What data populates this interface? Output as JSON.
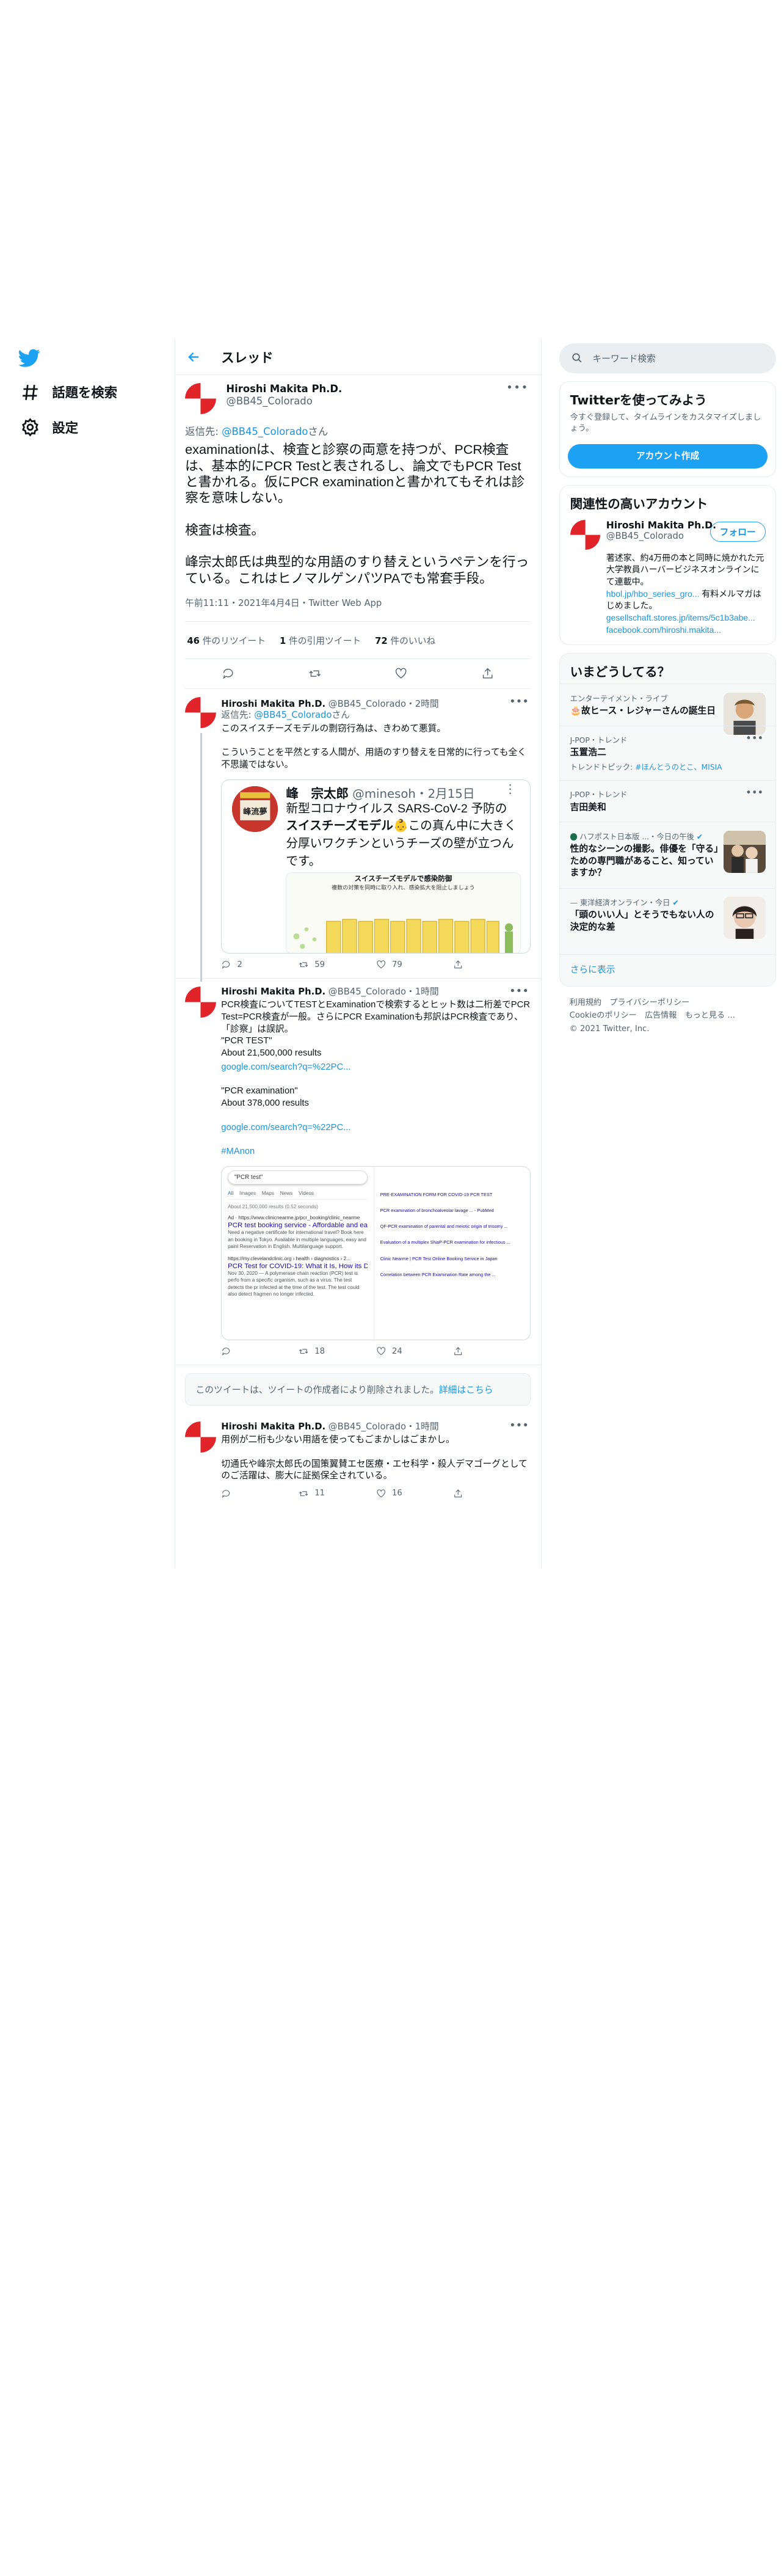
{
  "nav": {
    "explore": "話題を検索",
    "settings": "設定"
  },
  "header": {
    "title": "スレッド"
  },
  "main_tweet": {
    "name": "Hiroshi Makita Ph.D.",
    "handle": "@BB45_Colorado",
    "reply_prefix": "返信先: ",
    "reply_handle": "@BB45_Colorado",
    "reply_suffix": "さん",
    "text": "examinationは、検査と診察の両意を持つが、PCR検査は、基本的にPCR Testと表されるし、論文でもPCR Testと書かれる。仮にPCR examinationと書かれてもそれは診察を意味しない。\n\n検査は検査。\n\n峰宗太郎氏は典型的な用語のすり替えというペテンを行っている。これはヒノマルゲンパツPAでも常套手段。",
    "meta": "午前11:11・2021年4月4日・Twitter Web App",
    "retweets_count": "46",
    "retweets_label": " 件のリツイート",
    "quotes_count": "1",
    "quotes_label": " 件の引用ツイート",
    "likes_count": "72",
    "likes_label": " 件のいいね"
  },
  "reply1": {
    "name": "Hiroshi Makita Ph.D.",
    "meta": "@BB45_Colorado・2時間",
    "reply_prefix": "返信先: ",
    "reply_handle": "@BB45_Colorado",
    "reply_suffix": "さん",
    "text": "このスイスチーズモデルの剽窃行為は、きわめて悪質。\n\nこういうことを平然とする人間が、用語のすり替えを日常的に行っても全く不思議ではない。",
    "quote": {
      "name": "峰　宗太郎",
      "meta": "@minesoh・2月15日",
      "text_a": "新型コロナウイルス SARS-CoV-2 予防の",
      "text_b": "スイスチーズモデル",
      "text_c": "この真ん中に大きく分厚いワクチンというチーズの壁が立つんです。",
      "image_title": "スイスチーズモデルで感染防御",
      "image_sub": "複数の対策を同時に取り入れ、感染拡大を阻止しましょう",
      "avatar_text": "峰流夢"
    },
    "replies": "2",
    "retweets": "59",
    "likes": "79"
  },
  "reply2": {
    "name": "Hiroshi Makita Ph.D.",
    "meta": "@BB45_Colorado・1時間",
    "text": "PCR検査についてTESTとExaminationで検索するとヒット数は二桁差でPCR Test=PCR検査が一般。さらにPCR Examinationも邦訳はPCR検査であり、「診察」は誤訳。\n\"PCR TEST\"\nAbout 21,500,000 results",
    "link1": "google.com/search?q=%22PC...",
    "text2": "\"PCR examination\"\nAbout 378,000 results",
    "link2": "google.com/search?q=%22PC...",
    "hashtag": "#MAnon",
    "shot": {
      "query": "\"PCR test\"",
      "tabs": [
        "All",
        "Images",
        "Maps",
        "News",
        "Videos"
      ],
      "count": "About 21,500,000 results (0.52 seconds)",
      "ad": "Ad · https://www.clinicnearme.jp/pcr_booking/clinic_nearme",
      "r1": "PCR test booking service - Affordable and ea",
      "r1d": "Need a negative certificate for international travel? Book here an booking in Tokyo. Available in multiple languages, easy and painl Reservation in English. Multilanguage support.",
      "src2": "https://my.clevelandclinic.org › health › diagnostics › 2...",
      "r2": "PCR Test for COVID-19: What it Is, How its D",
      "r2d": "Nov 30, 2020 — A polymerase chain reaction (PCR) test is perfo from a specific organism, such as a virus. The test detects the pr infected at the time of the test. The test could also detect fragmen no longer infected.",
      "right1": "PRE-EXAMINATION FORM FOR COVID-19 PCR TEST",
      "right2": "PCR examination of bronchoalveolar lavage ... - PubMed",
      "right3": "QF-PCR examination of parental and meiotic origin of trisomy ...",
      "right4": "Evaluation of a multiplex SNaP-PCR examination for infectious ...",
      "right5": "Clinic Nearme | PCR Test Online Booking Service in Japan",
      "right6": "Correlation between PCR Examination Rate among the ..."
    },
    "replies": "",
    "retweets": "18",
    "likes": "24"
  },
  "deleted": {
    "text": "このツイートは、ツイートの作成者により削除されました。",
    "link": "詳細はこちら"
  },
  "reply3": {
    "name": "Hiroshi Makita Ph.D.",
    "meta": "@BB45_Colorado・1時間",
    "text": "用例が二桁も少ない用語を使ってもごまかしはごまかし。\n\n切通氏や峰宗太郎氏の国策翼賛エセ医療・エセ科学・殺人デマゴーグとしてのご活躍は、膨大に証拠保全されている。",
    "retweets": "11",
    "likes": "16"
  },
  "right": {
    "search_placeholder": "キーワード検索",
    "signup": {
      "title": "Twitterを使ってみよう",
      "desc": "今すぐ登録して、タイムラインをカスタマイズしましょう。",
      "button": "アカウント作成"
    },
    "related": {
      "title": "関連性の高いアカウント",
      "name": "Hiroshi Makita Ph.D.",
      "handle": "@BB45_Colorado",
      "follow": "フォロー",
      "bio1": "著述家、約4万冊の本と同時に焼かれた元大学教員ハーバービジネスオンラインにて連載中。",
      "bio_link1": "hbol.jp/hbo_series_gro...",
      "bio2": " 有料メルマガはじめました。",
      "bio_link2": "gesellschaft.stores.jp/items/5c1b3abe...",
      "bio_link3": " facebook.com/hiroshi.makita..."
    },
    "trends": {
      "title": "いまどうしてる？",
      "items": [
        {
          "meta": "エンターテイメント・ライブ",
          "title": "🎂故ヒース・レジャーさんの誕生日",
          "sub": ""
        },
        {
          "meta": "J-POP・トレンド",
          "title": "玉置浩二",
          "sub": "トレンドトピック: ",
          "sub_link": "#ほんとうのとこ、MISIA"
        },
        {
          "meta": "J-POP・トレンド",
          "title": "吉田美和",
          "sub": ""
        },
        {
          "meta": "ハフポスト日本版 ...・今日の午後",
          "title": "性的なシーンの撮影。俳優を「守る」ための専門職があること、知っていますか？",
          "sub": ""
        },
        {
          "meta": "東洋経済オンライン・今日",
          "title": "「頭のいい人」とそうでもない人の決定的な差",
          "sub": ""
        }
      ],
      "more": "さらに表示"
    },
    "footer": [
      "利用規約",
      "プライバシーポリシー",
      "Cookieのポリシー",
      "広告情報",
      "もっと見る ...",
      "© 2021 Twitter, Inc."
    ]
  },
  "colors": {
    "accent": "#1da1f2",
    "link": "#1b95e0",
    "avatar_red": "#e0242a"
  }
}
